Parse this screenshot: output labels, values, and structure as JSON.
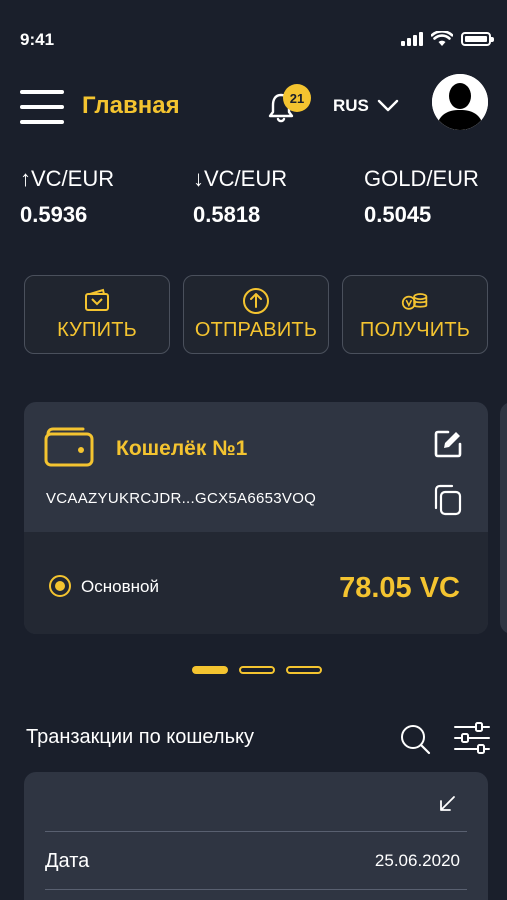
{
  "status_bar": {
    "time": "9:41"
  },
  "header": {
    "title": "Главная",
    "notifications_count": "21",
    "language": "RUS"
  },
  "rates": [
    {
      "label": "↑VC/EUR",
      "value": "0.5936"
    },
    {
      "label": "↓VC/EUR",
      "value": "0.5818"
    },
    {
      "label": "GOLD/EUR",
      "value": "0.5045"
    }
  ],
  "actions": {
    "buy": "КУПИТЬ",
    "send": "ОТПРАВИТЬ",
    "receive": "ПОЛУЧИТЬ"
  },
  "wallet": {
    "name": "Кошелёк №1",
    "address": "VCAAZYUKRCJDR...GCX5A6653VOQ",
    "primary_label": "Основной",
    "balance": "78.05 VC"
  },
  "transactions": {
    "title": "Транзакции по кошельку",
    "date_label": "Дата",
    "date_value": "25.06.2020"
  },
  "colors": {
    "background": "#1a1f2b",
    "accent": "#f4c430",
    "card": "#2f3542"
  }
}
